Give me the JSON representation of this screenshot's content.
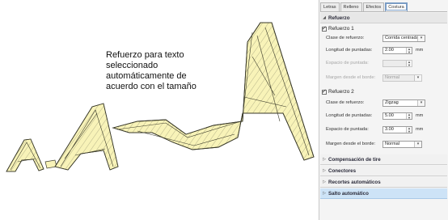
{
  "caption": "Refuerzo para texto\nseleccionado\nautomáticamente de\nacuerdo con el tamaño",
  "colors": {
    "letter_fill": "#f8f3b8",
    "letter_stroke": "#3a3a2a",
    "panel_bg": "#f4f4f4",
    "accent": "#cde3f7"
  },
  "tabs": [
    "Letras",
    "Relleno",
    "Efectos",
    "Costura"
  ],
  "active_tab": "Costura",
  "refuerzo": {
    "title": "Refuerzo",
    "refuerzo1": {
      "label": "Refuerzo 1",
      "clase_label": "Clase de refuerzo:",
      "clase_value": "Corrida centrada",
      "longitud_label": "Longitud de puntadas:",
      "longitud_value": "2.00",
      "espacio_label": "Espacio de puntada:",
      "espacio_value": "",
      "margen_label": "Margen desde el borde:",
      "margen_value": "Normal",
      "unit": "mm"
    },
    "refuerzo2": {
      "label": "Refuerzo 2",
      "clase_label": "Clase de refuerzo:",
      "clase_value": "Zigzag",
      "longitud_label": "Longitud de puntadas:",
      "longitud_value": "5.00",
      "espacio_label": "Espacio de puntada:",
      "espacio_value": "3.00",
      "margen_label": "Margen desde el borde:",
      "margen_value": "Normal",
      "unit": "mm"
    }
  },
  "sections": [
    {
      "title": "Compensación de tire"
    },
    {
      "title": "Conectores"
    },
    {
      "title": "Recortes automáticos"
    },
    {
      "title": "Salto automático"
    }
  ]
}
